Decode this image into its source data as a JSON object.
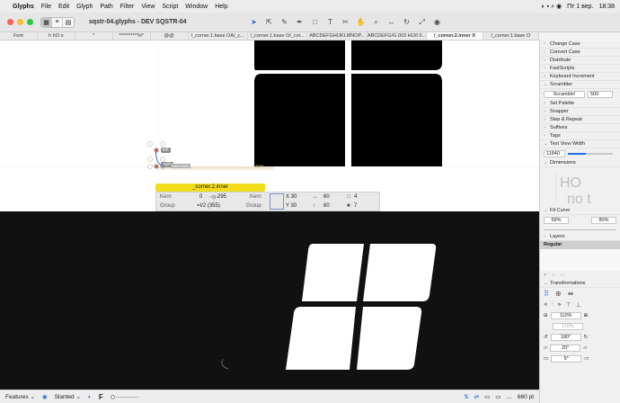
{
  "menubar": {
    "app": "Glyphs",
    "items": [
      "File",
      "Edit",
      "Glyph",
      "Path",
      "Filter",
      "View",
      "Script",
      "Window",
      "Help"
    ],
    "date": "Пт 1 вер.",
    "time": "18:38"
  },
  "window": {
    "title": "sqstr-04.glyphs - DEV SQSTR-04"
  },
  "tabs": [
    "Font",
    "h hO o",
    "*",
    "**********H*",
    "@@",
    "/_corner.1.base OA/_c...",
    "/_corner.1.base O/_cor...",
    "ABCDEFGHIJKLMNOP...",
    "ABCDEFG/G.003 HIJ/I.0...",
    "/_corner.2.inner X",
    "/_corner.1.base O"
  ],
  "active_tab_index": 9,
  "canvas": {
    "node_labels": [
      "left",
      "right"
    ],
    "corner_tags": [
      "base",
      "base",
      "rotate"
    ],
    "kern_glyph": "_corner.2.inner",
    "info": {
      "kern_label_1": "Kern",
      "group_label_1": "Group",
      "kern_value_left": "0",
      "width_value": "295",
      "group_value": "=I/2 (355)",
      "kern_label_2": "Kern",
      "group_label_2": "Group",
      "x": "X 30",
      "y": "Y 30",
      "w": "60",
      "h": "60",
      "count_1": "4",
      "count_2": "7"
    }
  },
  "statusbar": {
    "features": "Features",
    "slanted": "Slanted",
    "f_label": "F",
    "zoom": "660 pt"
  },
  "sidebar": {
    "items_top": [
      "Change Case",
      "Convert Case",
      "Distribute",
      "FastScripts",
      "Keyboard Increment"
    ],
    "scrambler": {
      "label": "Scrambler",
      "button": "Scramble!",
      "value": "500"
    },
    "items_mid": [
      "Set Palette",
      "Snapper",
      "Step & Repeat",
      "Suffixes",
      "Tags"
    ],
    "text_view_width": {
      "label": "Text View Width",
      "value": "11840"
    },
    "dimensions": {
      "label": "Dimensions"
    },
    "fit_curve": {
      "label": "Fit Curve",
      "v1": "58%",
      "v2": "80%"
    },
    "layers": {
      "label": "Layers",
      "selected": "Regular"
    },
    "transformations": {
      "label": "Transformations",
      "scale": "110%",
      "scale2": "110%",
      "rotate": "180°",
      "slant": "20°",
      "slant2": "5°"
    }
  },
  "colors": {
    "accent": "#1e6fe0",
    "kern_bar": "#f2dd1c",
    "glyph_top": "#000000",
    "glyph_bottom": "#ffffff",
    "preview_bg": "#111111"
  }
}
